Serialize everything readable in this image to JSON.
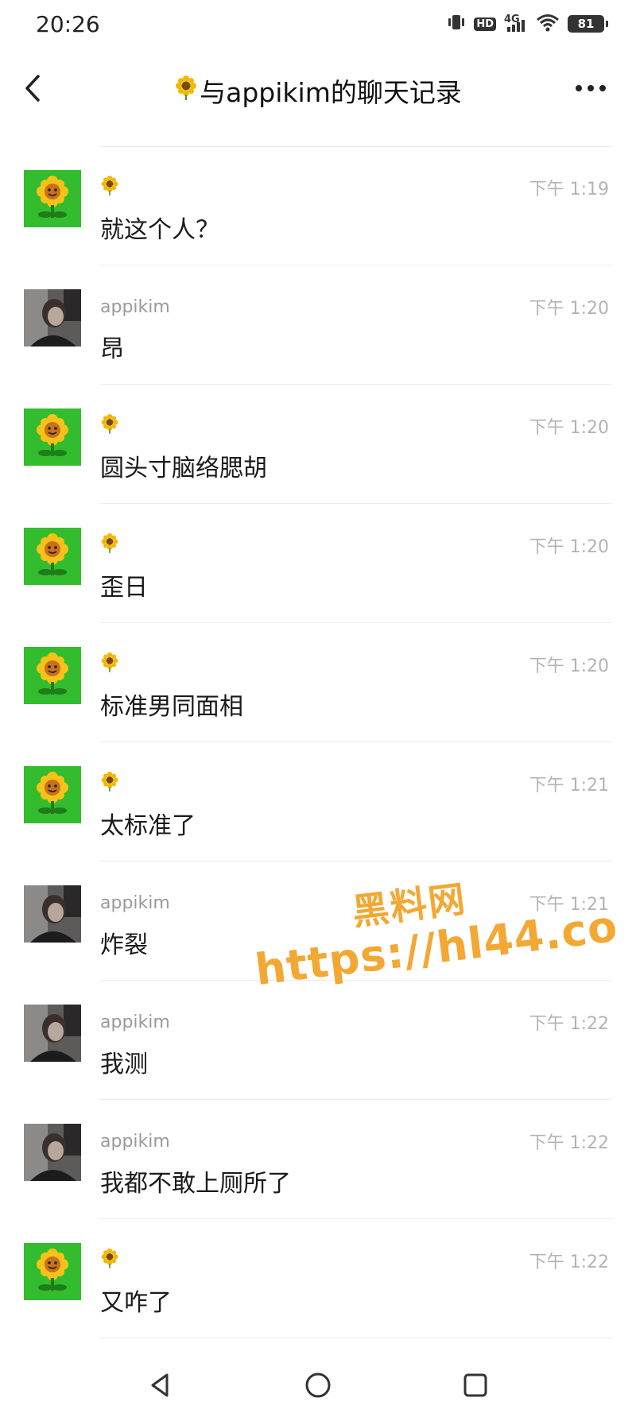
{
  "status_bar": {
    "time": "20:26",
    "hd": "HD",
    "network": "4G",
    "battery": "81",
    "icons": [
      "vibrate-icon",
      "hd-icon",
      "signal-icon",
      "wifi-icon",
      "battery-icon"
    ]
  },
  "header": {
    "title_emoji": "🌻",
    "title": "与appikim的聊天记录",
    "back_icon": "chevron-left-icon",
    "more_icon": "more-dots-icon"
  },
  "messages": [
    {
      "sender": "🌻",
      "avatar": "sunflower",
      "time": "下午 1:19",
      "text": "就这个人？"
    },
    {
      "sender": "appikim",
      "avatar": "person",
      "time": "下午 1:20",
      "text": "昂"
    },
    {
      "sender": "🌻",
      "avatar": "sunflower",
      "time": "下午 1:20",
      "text": "圆头寸脑络腮胡"
    },
    {
      "sender": "🌻",
      "avatar": "sunflower",
      "time": "下午 1:20",
      "text": "歪日"
    },
    {
      "sender": "🌻",
      "avatar": "sunflower",
      "time": "下午 1:20",
      "text": "标准男同面相"
    },
    {
      "sender": "🌻",
      "avatar": "sunflower",
      "time": "下午 1:21",
      "text": "太标准了"
    },
    {
      "sender": "appikim",
      "avatar": "person",
      "time": "下午 1:21",
      "text": "炸裂"
    },
    {
      "sender": "appikim",
      "avatar": "person",
      "time": "下午 1:22",
      "text": "我测"
    },
    {
      "sender": "appikim",
      "avatar": "person",
      "time": "下午 1:22",
      "text": "我都不敢上厕所了"
    },
    {
      "sender": "🌻",
      "avatar": "sunflower",
      "time": "下午 1:22",
      "text": "又咋了"
    }
  ],
  "watermark": {
    "line1": "黑料网",
    "line2": "https://hl44.co"
  },
  "nav_bar": {
    "icons": [
      "back-triangle-icon",
      "home-circle-icon",
      "recents-square-icon"
    ]
  },
  "colors": {
    "sunflower_bg": "#2fb52a",
    "watermark": "#f2a833",
    "divider": "#ececec",
    "meta_text": "#9a9a9a"
  }
}
